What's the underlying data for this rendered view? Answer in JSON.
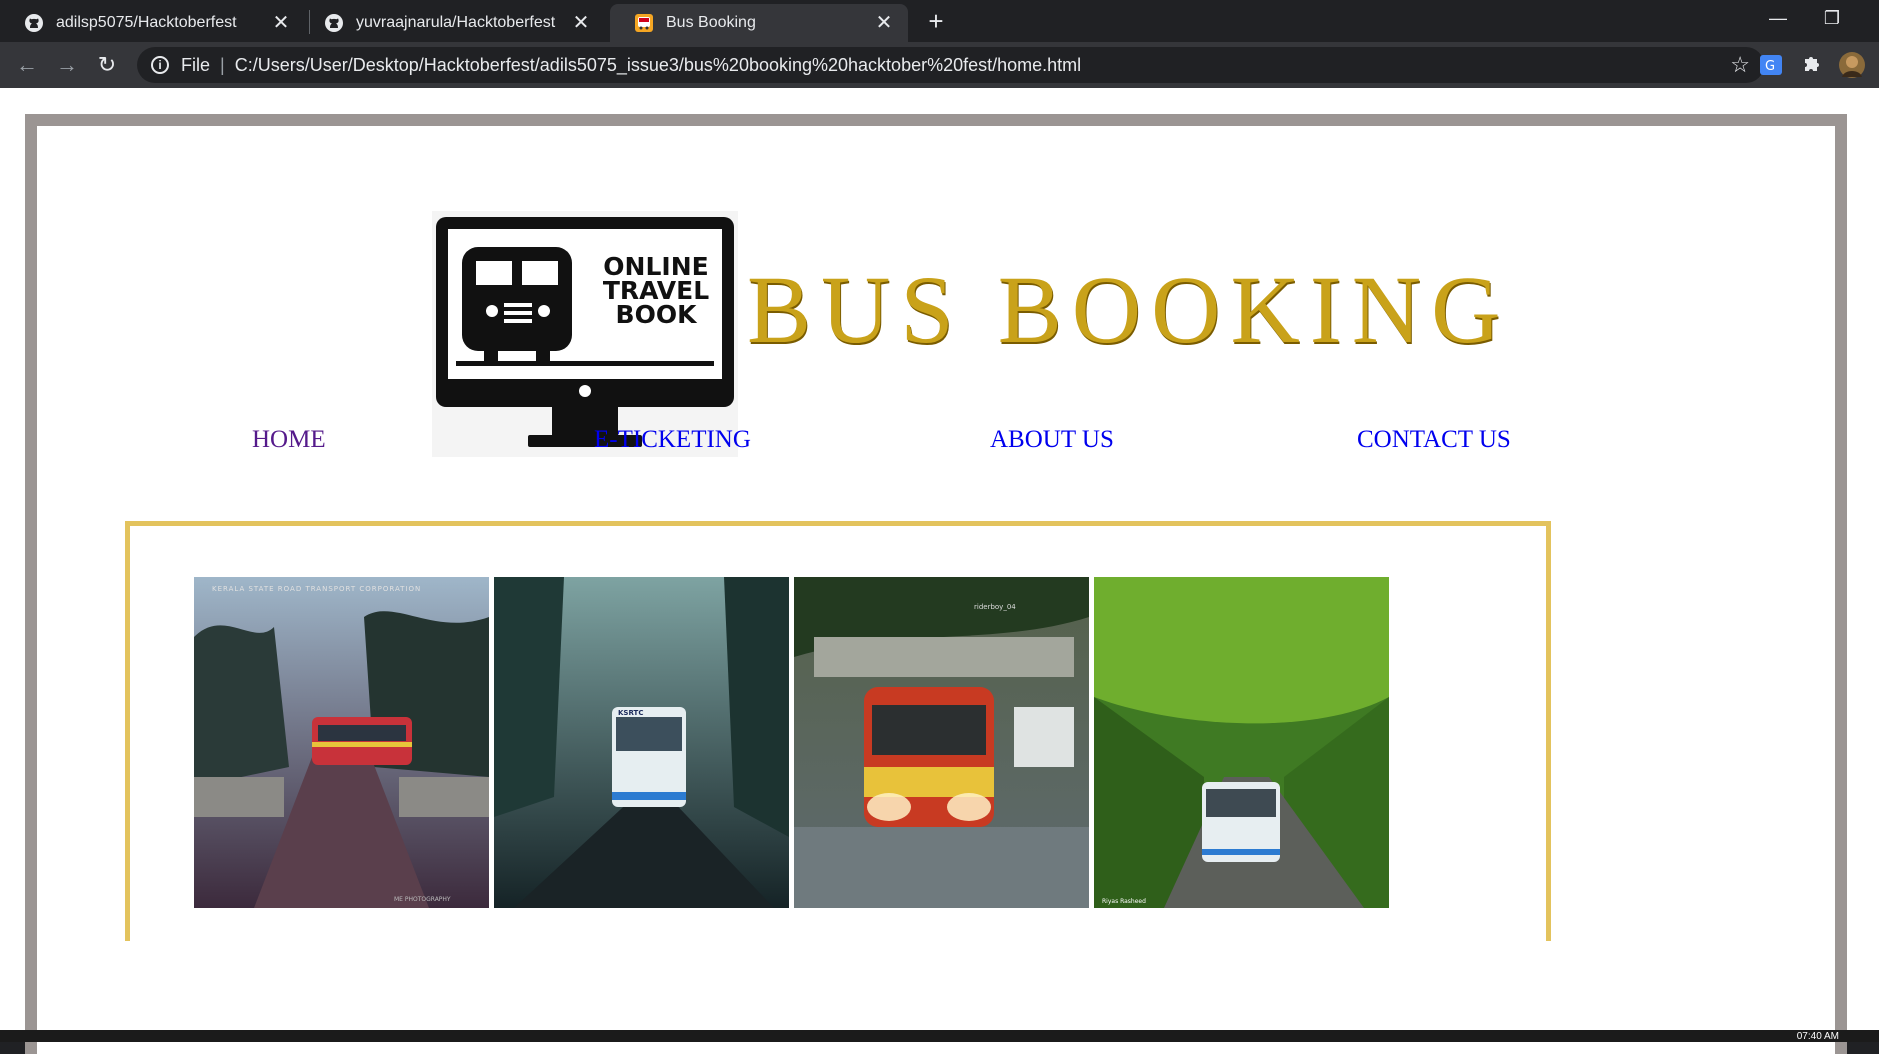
{
  "browser": {
    "tabs": [
      {
        "title": "adilsp5075/Hacktoberfest",
        "active": false,
        "icon": "github-icon"
      },
      {
        "title": "yuvraajnarula/Hacktoberfest",
        "active": false,
        "icon": "github-icon"
      },
      {
        "title": "Bus Booking",
        "active": true,
        "icon": "bus-favicon-icon"
      }
    ],
    "address": {
      "scheme_label": "File",
      "url": "C:/Users/User/Desktop/Hacktoberfest/adils5075_issue3/bus%20booking%20hacktober%20fest/home.html"
    }
  },
  "page": {
    "logo_text": [
      "ONLINE",
      "TRAVEL",
      "BOOK"
    ],
    "brand_title": "BUS BOOKING",
    "nav": [
      {
        "label": "HOME",
        "visited": true
      },
      {
        "label": "E-TICKETING",
        "visited": false
      },
      {
        "label": "ABOUT US",
        "visited": false
      },
      {
        "label": "CONTACT US",
        "visited": false
      }
    ],
    "gallery": [
      {
        "caption": "KERALA STATE ROAD TRANSPORT CORPORATION",
        "bus_label": "",
        "credit": "ME PHOTOGRAPHY"
      },
      {
        "caption": "",
        "bus_label": "KSRTC",
        "credit": ""
      },
      {
        "caption": "",
        "bus_label": "",
        "credit": "riderboy_04"
      },
      {
        "caption": "",
        "bus_label": "",
        "credit": "Riyas Rasheed"
      }
    ]
  },
  "taskbar": {
    "clock": "07:40 AM"
  },
  "colors": {
    "frame_border": "#9b9593",
    "gallery_border": "#e3c35d",
    "brand_gold": "#c9a21a",
    "link": "#0000ee",
    "visited": "#551a8b"
  }
}
